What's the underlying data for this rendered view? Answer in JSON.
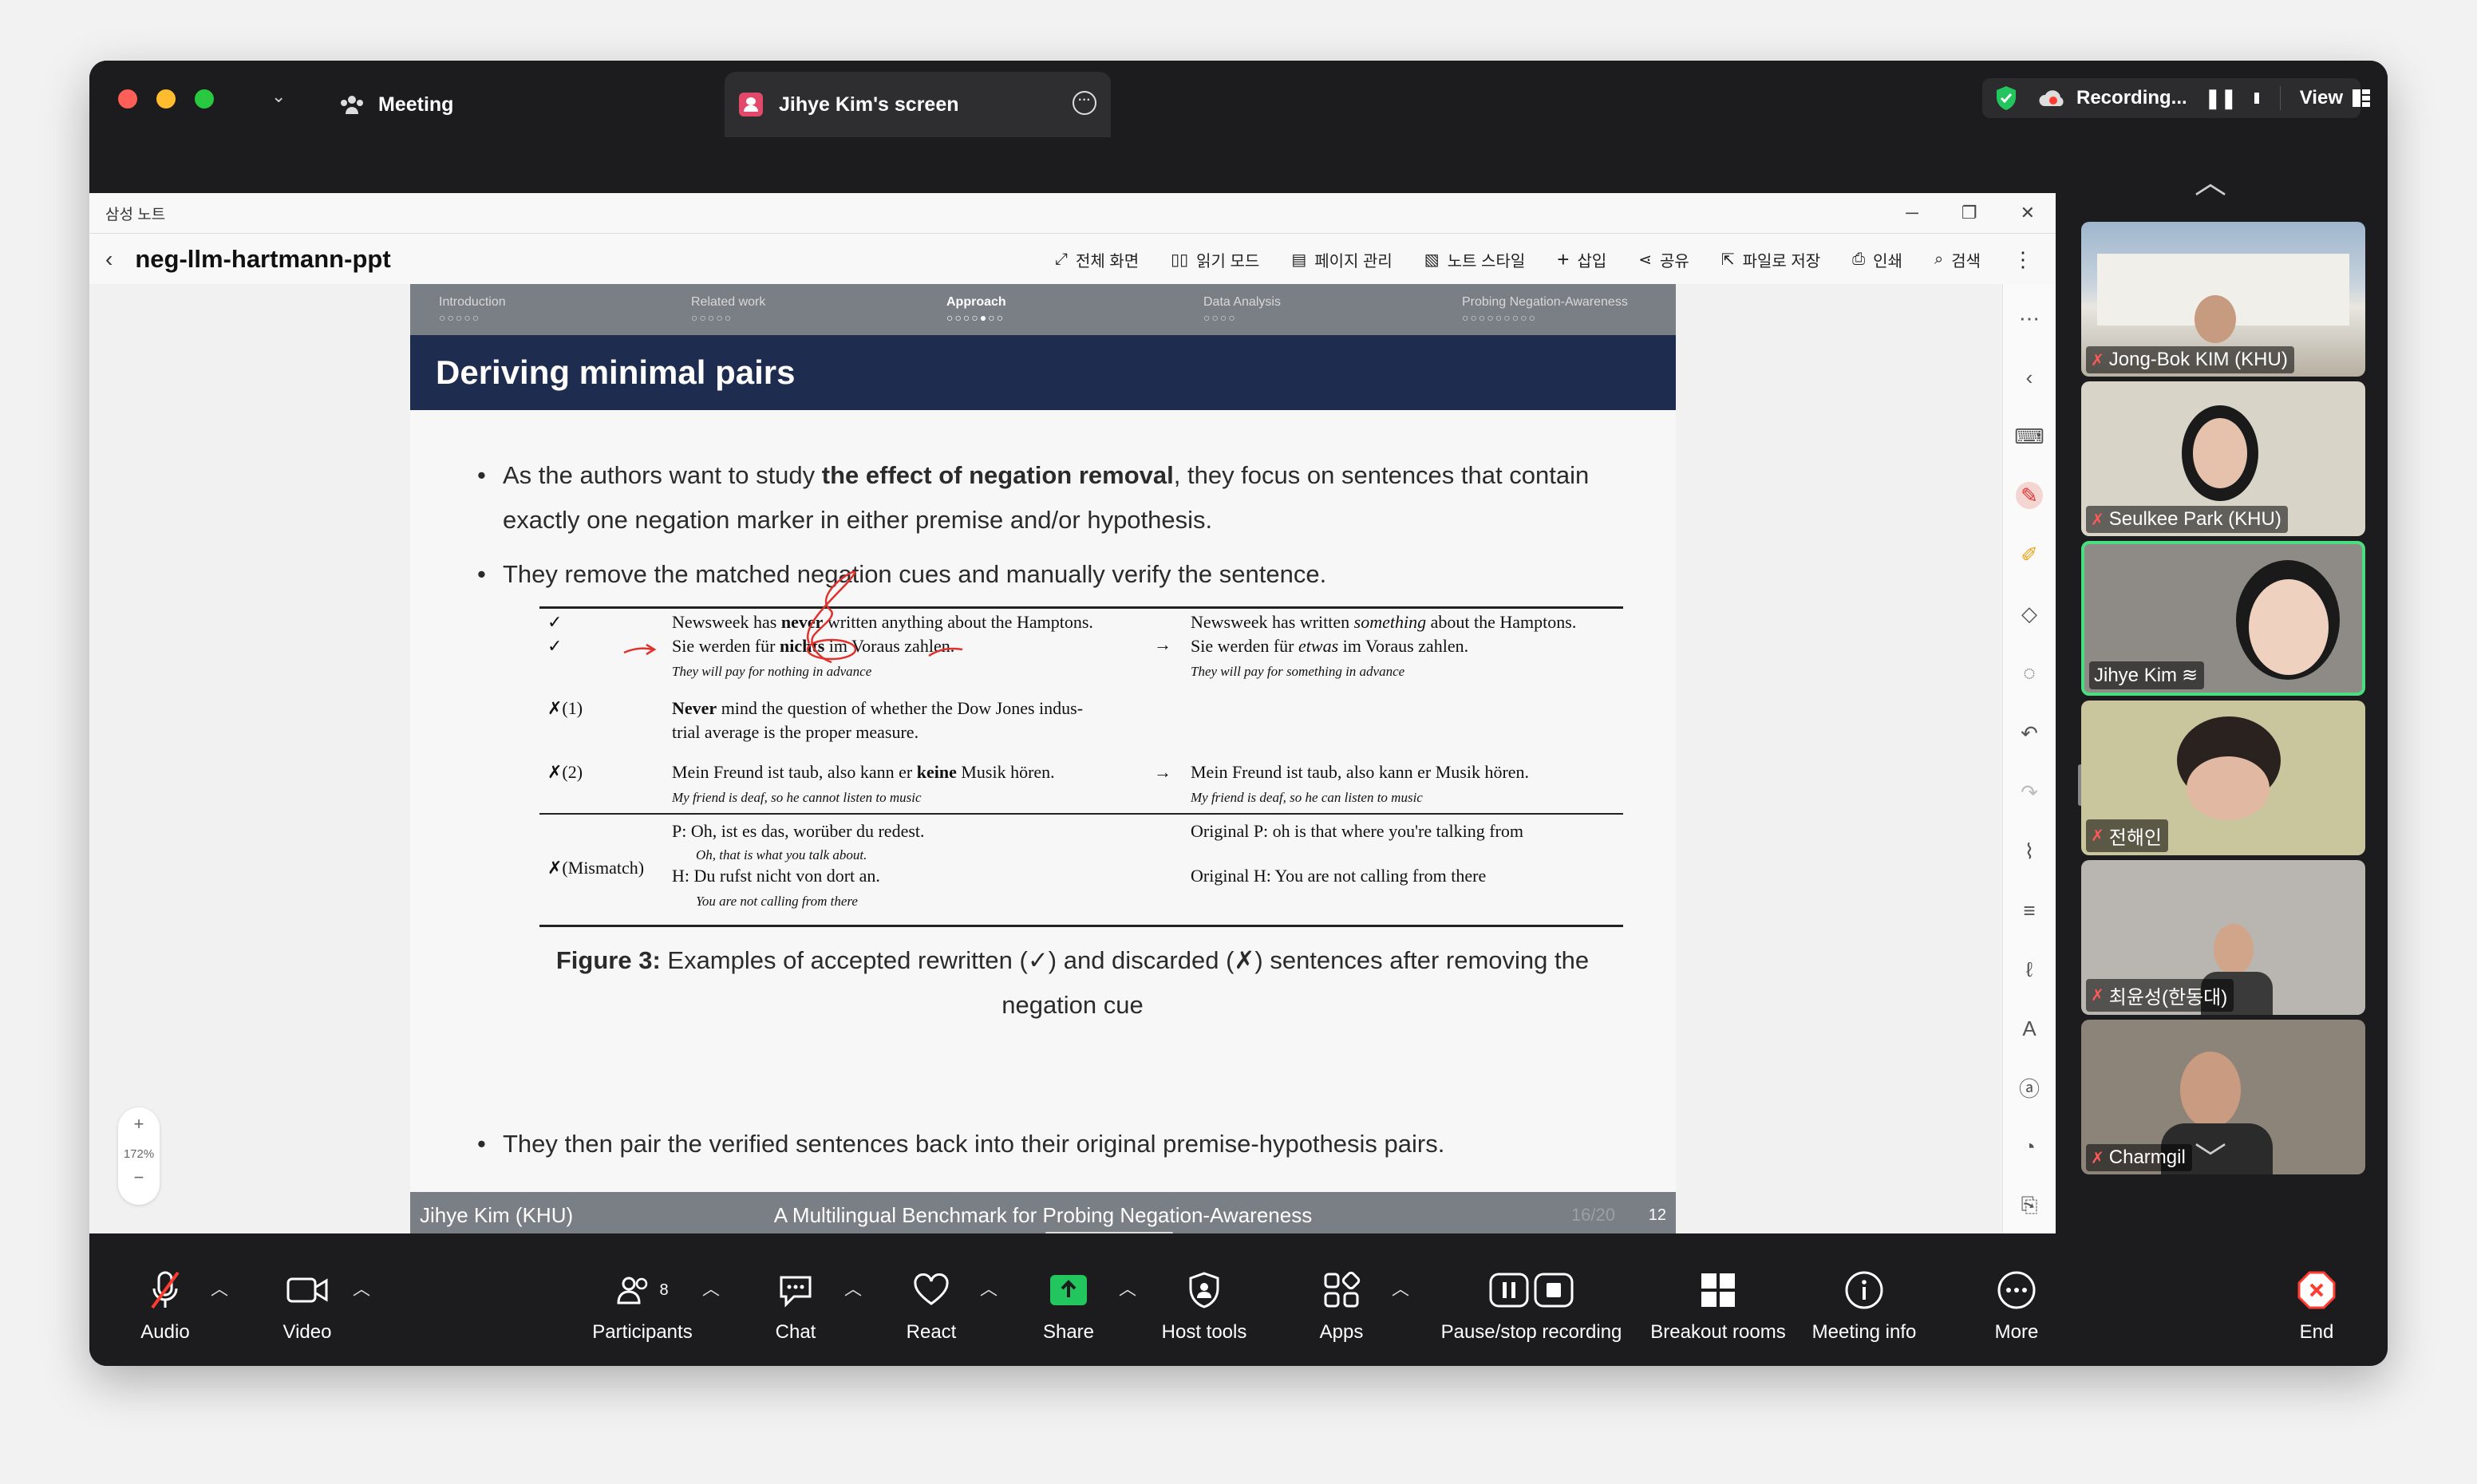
{
  "window": {
    "meeting_tab": "Meeting",
    "share_tab": "Jihye Kim's screen",
    "recording_label": "Recording...",
    "view_label": "View"
  },
  "notes_app": {
    "app_title": "삼성 노트",
    "doc_title": "neg-llm-hartmann-ppt",
    "toolbar": [
      "전체 화면",
      "읽기 모드",
      "페이지 관리",
      "노트 스타일",
      "삽입",
      "공유",
      "파일로 저장",
      "인쇄",
      "검색"
    ],
    "zoom": "172%"
  },
  "slide": {
    "nav": [
      {
        "label": "Introduction",
        "dots": "○○○○○"
      },
      {
        "label": "Related work",
        "dots": "○○○○○"
      },
      {
        "label": "Approach",
        "dots": "○○○○●○○"
      },
      {
        "label": "Data Analysis",
        "dots": "○○○○"
      },
      {
        "label": "Probing Negation-Awareness",
        "dots": "○○○○○○○○○"
      }
    ],
    "title": "Deriving minimal pairs",
    "bullet1_pre": "As the authors want to study ",
    "bullet1_bold": "the effect of negation removal",
    "bullet1_post": ", they focus on sentences that contain exactly one negation marker in either premise and/or hypothesis.",
    "bullet2": "They remove the matched negation cues and manually verify the sentence.",
    "table": {
      "r1_mark1": "✓",
      "r1_mark2": "✓",
      "r1_src1_a": "Newsweek has ",
      "r1_src1_b": "never",
      "r1_src1_c": " written anything about the Hamptons.",
      "r1_src2_a": "Sie werden für ",
      "r1_src2_b": "nichts",
      "r1_src2_c": " im Voraus zahlen.",
      "r1_src3": "They will pay for nothing in advance",
      "r1_arrow": "→",
      "r1_tgt1_a": "Newsweek has written ",
      "r1_tgt1_b": "something",
      "r1_tgt1_c": " about the Hamptons.",
      "r1_tgt2_a": "Sie werden für ",
      "r1_tgt2_b": "etwas",
      "r1_tgt2_c": " im Voraus zahlen.",
      "r1_tgt3": "They will pay for something in advance",
      "r2_mark": "✗(1)",
      "r2_src1_b": "Never",
      "r2_src1_c": " mind the question of whether the Dow Jones indus-",
      "r2_src2": "trial average is the proper measure.",
      "r3_mark": "✗(2)",
      "r3_src1_a": "Mein Freund ist taub, also kann er ",
      "r3_src1_b": "keine",
      "r3_src1_c": " Musik hören.",
      "r3_src2": "My friend is deaf, so he cannot listen to music",
      "r3_arrow": "→",
      "r3_tgt1": "Mein Freund ist taub, also kann er Musik hören.",
      "r3_tgt2": "My friend is deaf, so he can listen to music",
      "r4_mark": "✗(Mismatch)",
      "r4_p": "P: Oh, ist es das, worüber du redest.",
      "r4_p_gloss": "Oh, that is what you talk about.",
      "r4_h": "H: Du rufst nicht von dort an.",
      "r4_h_gloss": "You are not calling from there",
      "r4_orig_p": "Original P: oh is that where you're talking from",
      "r4_orig_h": "Original H: You are not calling from there"
    },
    "figure_label": "Figure 3:",
    "figure_caption": " Examples of accepted rewritten (✓) and discarded (✗) sentences after removing the negation cue",
    "bullet3": "They then pair the verified sentences back into their original premise-hypothesis pairs.",
    "footer_left": "Jihye Kim (KHU)",
    "footer_center": "A Multilingual Benchmark for Probing Negation-Awareness",
    "footer_page": "12",
    "footer_ghost": "16/20"
  },
  "participants_gallery": [
    {
      "name": "Jong-Bok KIM (KHU)",
      "bg": "#8aa0b8"
    },
    {
      "name": "Seulkee Park (KHU)",
      "bg": "#d9d4c8"
    },
    {
      "name": "Jihye Kim",
      "bg": "#8e8a86",
      "active": true
    },
    {
      "name": "전해인",
      "bg": "#c9c59c"
    },
    {
      "name": "최윤성(한동대)",
      "bg": "#b9b5b0"
    },
    {
      "name": "Charmgil",
      "bg": "#8c8379"
    }
  ],
  "controls": {
    "audio": "Audio",
    "video": "Video",
    "participants": "Participants",
    "participants_count": "8",
    "chat": "Chat",
    "react": "React",
    "share": "Share",
    "host_tools": "Host tools",
    "apps": "Apps",
    "pause_stop_recording": "Pause/stop recording",
    "breakout_rooms": "Breakout rooms",
    "meeting_info": "Meeting info",
    "more": "More",
    "end": "End"
  },
  "colors": {
    "share_green": "#22c55e",
    "active_border": "#4ade80",
    "end_red": "#ff3b30",
    "slide_title_bg": "#1e2c4f"
  }
}
